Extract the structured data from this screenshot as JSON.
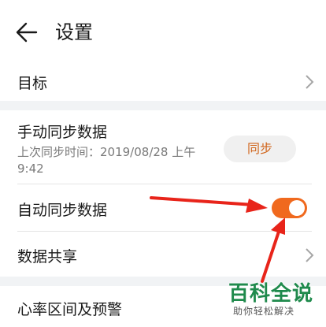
{
  "header": {
    "title": "设置",
    "back_icon": "back-arrow-icon"
  },
  "rows": {
    "target": {
      "label": "目标"
    },
    "manual_sync": {
      "label": "手动同步数据",
      "last_sync_line1": "上次同步时间：2019/08/28 上午",
      "last_sync_line2": "9:42",
      "button": "同步"
    },
    "auto_sync": {
      "label": "自动同步数据",
      "enabled": true
    },
    "data_share": {
      "label": "数据共享"
    },
    "heart_rate": {
      "label": "心率区间及预警"
    }
  },
  "colors": {
    "accent": "#f0691e",
    "annotation": "#e8241a",
    "watermark": "#1f8a4c"
  },
  "watermark": {
    "title": "百科全说",
    "subtitle": "助你轻松解决"
  }
}
